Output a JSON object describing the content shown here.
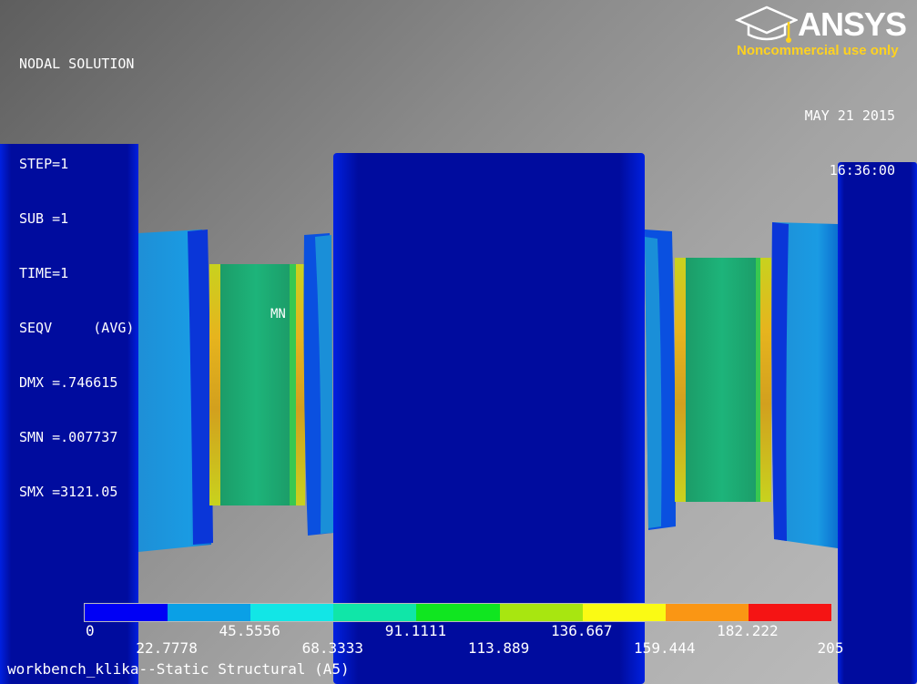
{
  "header": {
    "title": "NODAL SOLUTION",
    "step": "STEP=1",
    "sub": "SUB =1",
    "time": "TIME=1",
    "result": "SEQV     (AVG)",
    "dmx": "DMX =.746615",
    "smn": "SMN =.007737",
    "smx": "SMX =3121.05"
  },
  "logo": {
    "brand": "ANSYS",
    "notice": "Noncommercial use only"
  },
  "timestamp": {
    "date": "MAY 21 2015",
    "time": "16:36:00"
  },
  "marker": {
    "min_label": "MN"
  },
  "legend": {
    "colors": [
      "#0000f5",
      "#0aa0e6",
      "#12e6e6",
      "#10e6a8",
      "#10e620",
      "#a8e610",
      "#fafa14",
      "#fa9614",
      "#f51414"
    ],
    "labels_top": [
      "0",
      "45.5556",
      "91.1111",
      "136.667",
      "182.222"
    ],
    "labels_bottom": [
      "22.7778",
      "68.3333",
      "113.889",
      "159.444",
      "205"
    ]
  },
  "footer": {
    "job_name": "workbench_klika--Static Structural (A5)"
  },
  "colors": {
    "deep_blue": "#000a9e",
    "bright_blue": "#0017d8",
    "light_blue": "#1a93d9",
    "green": "#1aad73",
    "background": "#9a9a9a"
  }
}
